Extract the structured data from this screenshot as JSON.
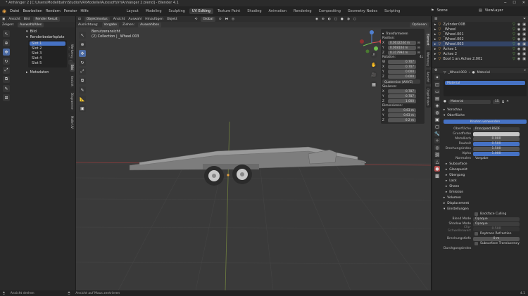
{
  "app": {
    "title": "* Anhänger 2 [C:\\Users\\ModellbahnStudio\\VR\\Modelle\\Autosoft\\Vr\\Anhänger 2.blend] - Blender 4.1",
    "version": "4.1"
  },
  "menu": [
    "Datei",
    "Bearbeiten",
    "Rendern",
    "Fenster",
    "Hilfe"
  ],
  "workspaces": [
    "Layout",
    "Modeling",
    "Sculpting",
    "UV Editing",
    "Texture Paint",
    "Shading",
    "Animation",
    "Rendering",
    "Compositing",
    "Geometry Nodes",
    "Scripting"
  ],
  "active_workspace": "UV Editing",
  "scene": {
    "label": "Scene",
    "view_layer": "ViewLayer"
  },
  "image_editor": {
    "header": [
      "Ansicht",
      "Bild"
    ],
    "image_name": "Render Result",
    "show_label": "Zeigen:",
    "show_value": "Auswahl/Alles",
    "bild_title": "Bild",
    "slot_label": "Renderbedarfsplatz",
    "slots": [
      "Slot 1",
      "Slot 2",
      "Slot 3",
      "Slot 4",
      "Slot 5"
    ],
    "metadata": "Metadaten",
    "tabs": [
      "Werkzeug",
      "Bild",
      "Ansicht",
      "Diagramme",
      "Maße UV"
    ]
  },
  "viewport": {
    "mode": "Objektmodus",
    "menus": [
      "Ansicht",
      "Auswahl",
      "Hinzufügen",
      "Objekt"
    ],
    "orientation_label": "Ausrichtung:",
    "orientation_value": "Vorgabe",
    "drag_label": "Ziehen:",
    "drag_value": "Auswahlbox",
    "transform_orient": "Global",
    "options": "Optionen",
    "view_name": "Benutzeransicht",
    "object_line": "(2) Collection | _Wheel.003",
    "tabs": [
      "Element",
      "Werkzeug",
      "Ansicht",
      "Objektlisten"
    ]
  },
  "transform": {
    "title": "Transformieren",
    "position_label": "Position:",
    "position": [
      {
        "axis": "X",
        "value": "0.0032244 m"
      },
      {
        "axis": "Y",
        "value": "0.008104 m"
      },
      {
        "axis": "Z",
        "value": "0.317994 m"
      }
    ],
    "rotation_label": "Rotation:",
    "rotation_mode": "4L",
    "rotation": [
      {
        "axis": "W",
        "value": "0.707"
      },
      {
        "axis": "X",
        "value": "0.707"
      },
      {
        "axis": "Y",
        "value": "0.000"
      },
      {
        "axis": "Z",
        "value": "0.000"
      }
    ],
    "quat_label": "Quaternion (WXYZ)",
    "scale_label": "Skalieren:",
    "scale": [
      {
        "axis": "X",
        "value": "0.787"
      },
      {
        "axis": "Y",
        "value": "0.787"
      },
      {
        "axis": "Z",
        "value": "1.000"
      }
    ],
    "dims_label": "Dimensionen:",
    "dims": [
      {
        "axis": "X",
        "value": "0.63 m"
      },
      {
        "axis": "Y",
        "value": "0.63 m"
      },
      {
        "axis": "Z",
        "value": "0.2 m"
      }
    ]
  },
  "outliner": {
    "items": [
      {
        "name": "Zylinder.008",
        "color": "#e8a040"
      },
      {
        "name": "_Wheel",
        "color": "#e8a040"
      },
      {
        "name": "_Wheel.001",
        "color": "#e8a040"
      },
      {
        "name": "_Wheel.002",
        "color": "#e8a040"
      },
      {
        "name": "_Wheel.003",
        "color": "#e8a040"
      },
      {
        "name": "Achse 1",
        "color": "#e8a040"
      },
      {
        "name": "Achse 2",
        "color": "#e8a040"
      },
      {
        "name": "Bool 1 an Achse 2.001",
        "color": "#e8a040"
      }
    ]
  },
  "properties": {
    "object_name": "_Wheel.003",
    "material_tab": "Material",
    "material_slot": "Material",
    "material_name": "Material",
    "users": "15",
    "sections": {
      "preview": "Vorschau",
      "surface": "Oberfläche",
      "volume": "Volumen",
      "displacement": "Displacement",
      "settings": "Einstellungen"
    },
    "use_nodes": "Knoten verwenden",
    "surface_label": "Oberfläche",
    "surface_value": "Principled BSDF",
    "fields": [
      {
        "label": "Grundfarbe",
        "value": "",
        "type": "color"
      },
      {
        "label": "Metallisch",
        "value": "0.000",
        "type": "num"
      },
      {
        "label": "Rauheit",
        "value": "0.500",
        "type": "blue"
      },
      {
        "label": "Brechungsindex",
        "value": "1.500",
        "type": "num"
      },
      {
        "label": "Alpha",
        "value": "1.000",
        "type": "blue"
      },
      {
        "label": "Normalen",
        "value": "Vorgabe",
        "type": "text"
      }
    ],
    "subsections": [
      "Subsurface",
      "Glanzpunkt",
      "Übergang",
      "Lack",
      "Sheen",
      "Emission"
    ],
    "backface": "Backface Culling",
    "blend_label": "Blend Mode",
    "blend_value": "Opaque",
    "shadow_label": "Shadow Mode",
    "shadow_value": "Opaque",
    "clip_label": "Clip-Schwellenwert",
    "clip_value": "0.500",
    "raytrace": "Raytrace Refraction",
    "depth_label": "Brechungstiefe",
    "depth_value": "0 m",
    "sss": "Subsurface Translucency",
    "pass_label": "Durchgangsindex"
  },
  "status": {
    "left": "Ansicht drehen",
    "middle": "Ansicht auf Maus zentrieren",
    "right": "4.1"
  },
  "colors": {
    "accent": "#4672c4",
    "orange": "#e8a040",
    "green": "#6fbf4f"
  }
}
